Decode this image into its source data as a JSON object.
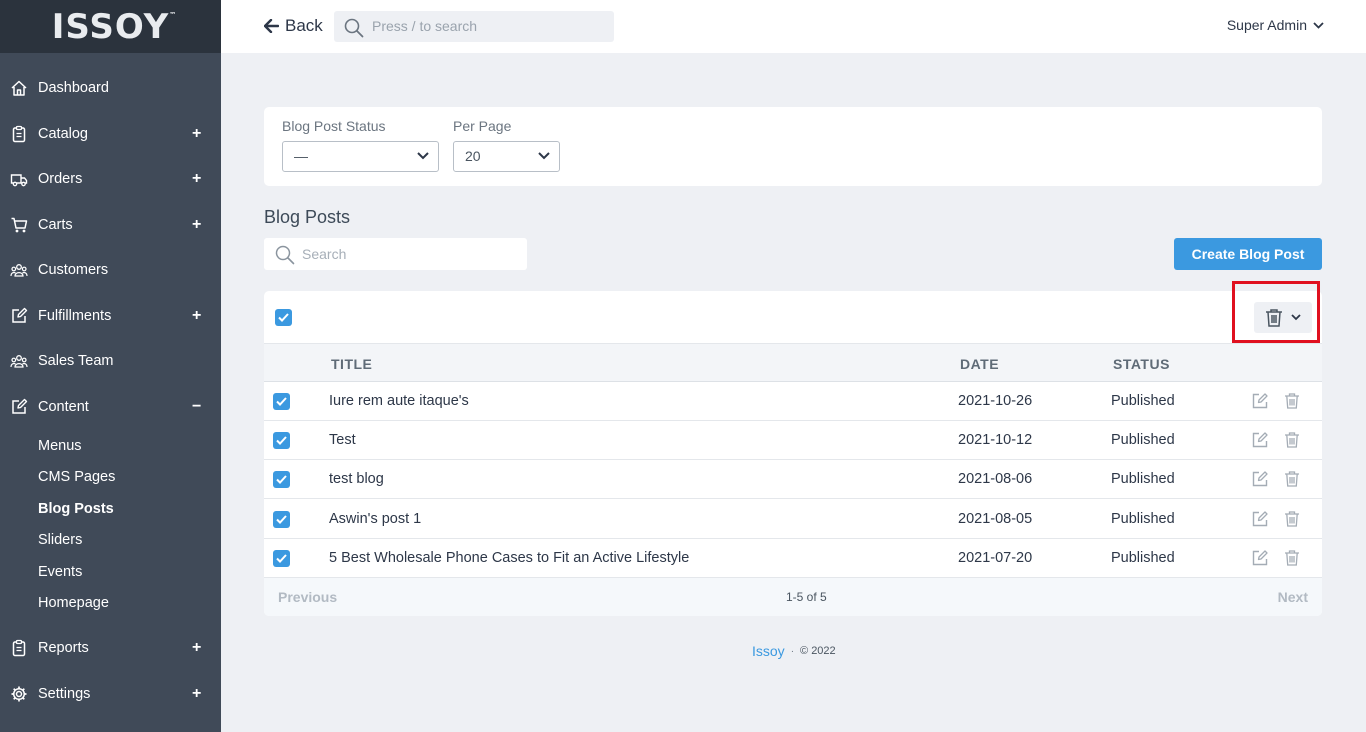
{
  "sidebar": {
    "logo": "ISSOY",
    "logo_tm": "™",
    "items": [
      {
        "label": "Dashboard",
        "icon": "home-icon",
        "toggle": ""
      },
      {
        "label": "Catalog",
        "icon": "clipboard-icon",
        "toggle": "+"
      },
      {
        "label": "Orders",
        "icon": "truck-icon",
        "toggle": "+"
      },
      {
        "label": "Carts",
        "icon": "cart-icon",
        "toggle": "+"
      },
      {
        "label": "Customers",
        "icon": "users-icon",
        "toggle": ""
      },
      {
        "label": "Fulfillments",
        "icon": "edit-icon",
        "toggle": "+"
      },
      {
        "label": "Sales Team",
        "icon": "users-icon",
        "toggle": ""
      },
      {
        "label": "Content",
        "icon": "edit-icon",
        "toggle": "−"
      },
      {
        "label": "Reports",
        "icon": "clipboard-icon",
        "toggle": "+"
      },
      {
        "label": "Settings",
        "icon": "gear-icon",
        "toggle": "+"
      }
    ],
    "content_sub": [
      "Menus",
      "CMS Pages",
      "Blog Posts",
      "Sliders",
      "Events",
      "Homepage"
    ],
    "active_sub": "Blog Posts"
  },
  "topbar": {
    "back_label": "Back",
    "search_placeholder": "Press / to search",
    "user_label": "Super Admin"
  },
  "filters": {
    "status_label": "Blog Post Status",
    "status_value": "—",
    "per_page_label": "Per Page",
    "per_page_value": "20"
  },
  "main": {
    "title": "Blog Posts",
    "search_placeholder": "Search",
    "create_button": "Create Blog Post"
  },
  "table": {
    "columns": [
      "TITLE",
      "DATE",
      "STATUS"
    ],
    "rows": [
      {
        "title": "Iure rem aute itaque's",
        "date": "2021-10-26",
        "status": "Published"
      },
      {
        "title": "Test",
        "date": "2021-10-12",
        "status": "Published"
      },
      {
        "title": "test blog",
        "date": "2021-08-06",
        "status": "Published"
      },
      {
        "title": "Aswin's post 1",
        "date": "2021-08-05",
        "status": "Published"
      },
      {
        "title": "5 Best Wholesale Phone Cases to Fit an Active Lifestyle",
        "date": "2021-07-20",
        "status": "Published"
      }
    ],
    "pagination": {
      "previous": "Previous",
      "count": "1-5 of 5",
      "next": "Next"
    }
  },
  "footer": {
    "brand": "Issoy",
    "separator": "·",
    "copyright": "© 2022"
  },
  "colors": {
    "sidebar": "#404a58",
    "logo_bar": "#2b333d",
    "accent": "#3b99e0",
    "highlight": "#e0101f"
  }
}
